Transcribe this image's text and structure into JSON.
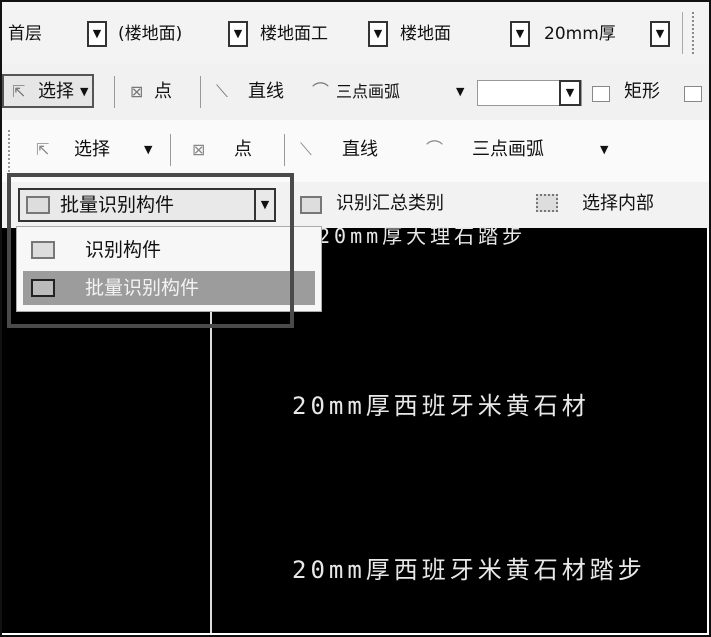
{
  "combos": {
    "floor": "首层",
    "category": "(楼地面)",
    "category2": "楼地面工",
    "type": "楼地面",
    "material": "20mm厚"
  },
  "toolbar1": {
    "select": "选择",
    "point": "点",
    "line": "直线",
    "arc": "三点画弧",
    "rect": "矩形"
  },
  "toolbar2": {
    "select": "选择",
    "point": "点",
    "line": "直线",
    "arc": "三点画弧"
  },
  "identify": {
    "batch": "批量识别构件",
    "summary": "识别汇总类别",
    "inner": "选择内部"
  },
  "menu": {
    "items": [
      "识别构件",
      "批量识别构件"
    ]
  },
  "canvas": {
    "top_text": "20mm厚大理石踏步",
    "text1": "20mm厚西班牙米黄石材",
    "text2": "20mm厚西班牙米黄石材踏步"
  }
}
